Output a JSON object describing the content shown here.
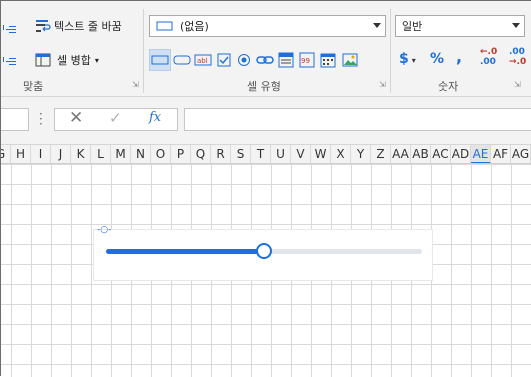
{
  "ribbon": {
    "alignment": {
      "wrap_text_label": "텍스트 줄 바꿈",
      "merge_cells_label": "셀 병합",
      "merge_caret": "▾",
      "group_label": "맞춤"
    },
    "cell_type": {
      "dropdown_value": "(없음)",
      "group_label": "셀 유형",
      "styles": [
        "plain-border",
        "rounded-border",
        "abl-text",
        "checkbox",
        "radio",
        "hyperlink",
        "combo-list",
        "numbered-list",
        "calendar",
        "image"
      ]
    },
    "number": {
      "format_value": "일반",
      "currency_label": "$",
      "currency_caret": "▾",
      "percent_label": "%",
      "comma_label": ",",
      "increase_decimal_label": ".00",
      "decrease_decimal_label": ".00",
      "group_label": "숫자"
    }
  },
  "formula_bar": {
    "cancel_glyph": "✕",
    "confirm_glyph": "✓",
    "fx_label": "fx",
    "value": ""
  },
  "columns": [
    "G",
    "H",
    "I",
    "J",
    "K",
    "L",
    "M",
    "N",
    "O",
    "P",
    "Q",
    "R",
    "S",
    "T",
    "U",
    "V",
    "W",
    "X",
    "Y",
    "Z",
    "AA",
    "AB",
    "AC",
    "AD",
    "AE",
    "AF",
    "AG"
  ],
  "active_column": "AE",
  "slider": {
    "value": 0.5,
    "accent_color": "#1e6fd9",
    "track_color": "#e1e4e8"
  }
}
